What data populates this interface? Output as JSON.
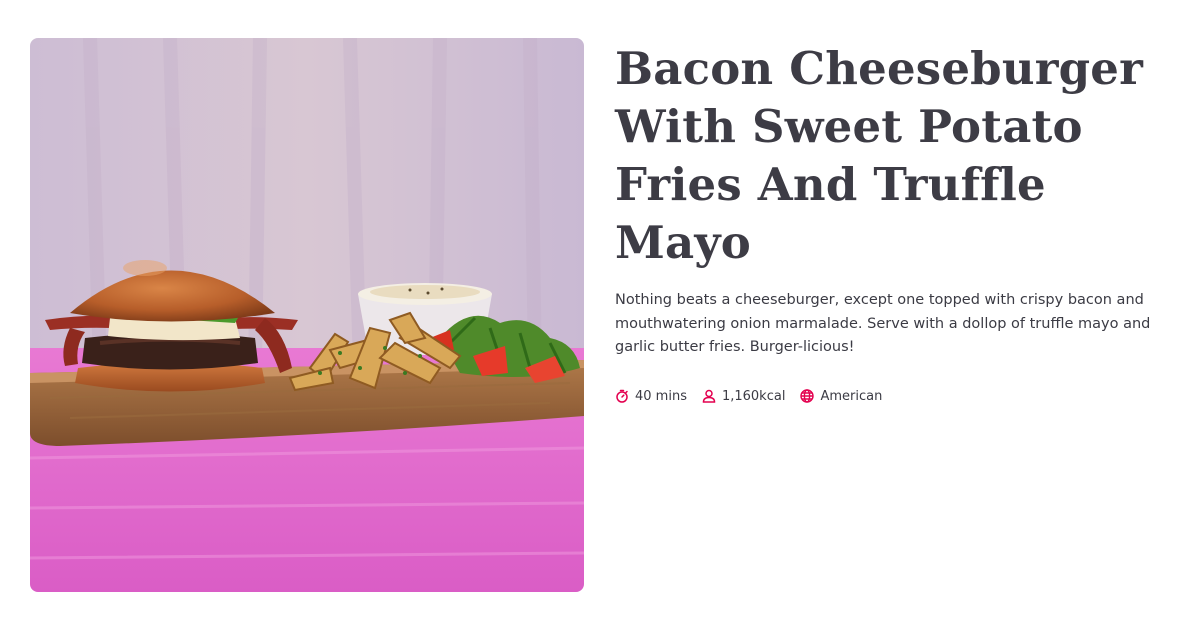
{
  "recipe": {
    "title_line_1": "Bacon Cheeseburger",
    "title_line_2": "With Sweet Potato",
    "title_line_3": "Fries And Truffle Mayo",
    "description": "Nothing beats a cheeseburger, except one topped with crispy bacon and mouthwatering onion marmalade. Serve with a dollop of truffle mayo and garlic butter fries. Burger-licious!",
    "image_alt": "Bacon cheeseburger with sweet potato fries, salad and truffle mayo on a wooden board"
  },
  "meta": {
    "time": {
      "icon": "stopwatch-icon",
      "label": "40 mins"
    },
    "calories": {
      "icon": "person-icon",
      "label": "1,160kcal"
    },
    "cuisine": {
      "icon": "globe-icon",
      "label": "American"
    }
  },
  "colors": {
    "accent": "#e3004f",
    "text": "#3b3b44",
    "title": "#3d3c45",
    "background": "#ffffff"
  }
}
